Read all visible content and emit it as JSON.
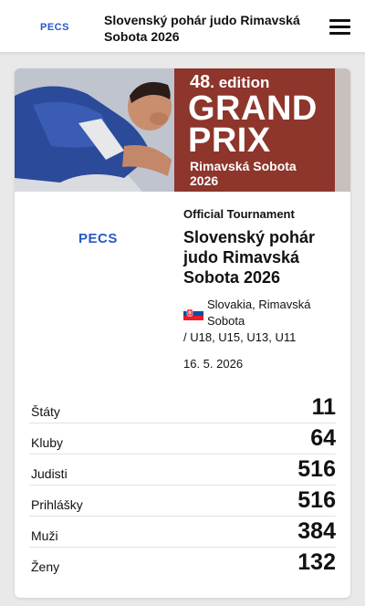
{
  "header": {
    "logo": "PECS",
    "title": "Slovenský pohár judo Rimavská Sobota 2026",
    "menu_icon": "hamburger-menu-icon"
  },
  "banner": {
    "edition_number": "48",
    "edition_suffix": ". edition",
    "line1": "GRAND",
    "line2": "PRIX",
    "place": "Rimavská Sobota",
    "year": "2026",
    "panel_color": "#8e352c"
  },
  "tournament": {
    "organizer_logo": "PECS",
    "type": "Official Tournament",
    "name": "Slovenský pohár judo Rimavská Sobota 2026",
    "country_flag": "slovakia-flag-icon",
    "location": "Slovakia, Rimavská Sobota",
    "categories": "/ U18, U15, U13, U11",
    "date": "16. 5. 2026"
  },
  "stats": [
    {
      "label": "Štáty",
      "value": "11"
    },
    {
      "label": "Kluby",
      "value": "64"
    },
    {
      "label": "Judisti",
      "value": "516"
    },
    {
      "label": "Prihlášky",
      "value": "516"
    },
    {
      "label": "Muži",
      "value": "384"
    },
    {
      "label": "Ženy",
      "value": "132"
    }
  ],
  "colors": {
    "brand_blue": "#2a58c5",
    "banner_red": "#8e352c"
  }
}
